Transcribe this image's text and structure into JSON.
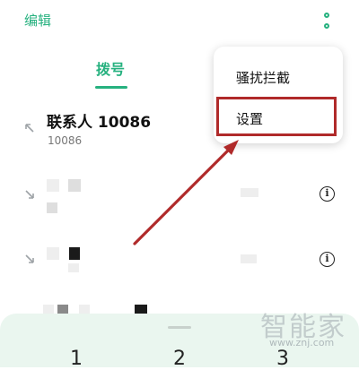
{
  "header": {
    "edit_label": "编辑",
    "more_icon": "more-vertical-icon"
  },
  "tabs": [
    {
      "label": "拨号"
    }
  ],
  "calls": [
    {
      "name": "联系人 10086",
      "number": "10086",
      "direction_icon": "outgoing-arrow-icon"
    },
    {
      "direction_icon": "incoming-arrow-icon",
      "info_icon": "info-icon"
    },
    {
      "direction_icon": "incoming-arrow-icon",
      "info_icon": "info-icon"
    }
  ],
  "menu": {
    "items": [
      {
        "label": "骚扰拦截"
      },
      {
        "label": "设置"
      }
    ]
  },
  "annotation": {
    "color": "#b02a2a"
  },
  "dialpad": {
    "digits": [
      "1",
      "2",
      "3"
    ]
  },
  "watermark": {
    "text": "智能家",
    "url": "www.znj.com"
  },
  "colors": {
    "accent": "#26b17f",
    "dialpad_bg": "#eaf6ef"
  }
}
